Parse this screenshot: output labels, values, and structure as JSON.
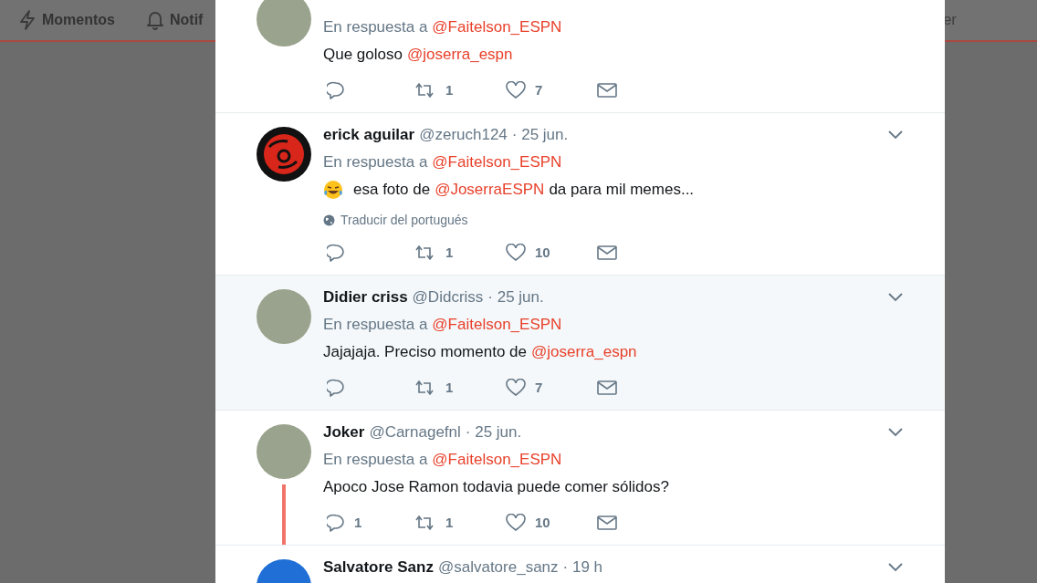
{
  "nav": {
    "items": [
      {
        "label": "Momentos"
      },
      {
        "label": "Notif"
      }
    ],
    "right_text": "er"
  },
  "tweets": [
    {
      "reply_prefix": "En respuesta a",
      "reply_to": "@Faitelson_ESPN",
      "text": [
        {
          "kind": "plain",
          "text": "Que goloso"
        },
        {
          "kind": "mention",
          "text": "@joserra_espn"
        }
      ],
      "retweets": "1",
      "likes": "7",
      "highlighted": false,
      "thread_continues": false
    },
    {
      "name": "erick aguilar",
      "handle": "@zeruch124",
      "time": "· 25 jun.",
      "reply_prefix": "En respuesta a",
      "reply_to": "@Faitelson_ESPN",
      "text": [
        {
          "kind": "emoji"
        },
        {
          "kind": "plain",
          "text": "esa foto de"
        },
        {
          "kind": "mention",
          "text": "@JoserraESPN"
        },
        {
          "kind": "plain",
          "text": "da para mil memes..."
        }
      ],
      "translate": "Traducir del portugués",
      "retweets": "1",
      "likes": "10",
      "highlighted": false,
      "thread_continues": false
    },
    {
      "name": "Didier criss",
      "handle": "@Didcriss",
      "time": "· 25 jun.",
      "reply_prefix": "En respuesta a",
      "reply_to": "@Faitelson_ESPN",
      "text": [
        {
          "kind": "plain",
          "text": "Jajajaja. Preciso momento de"
        },
        {
          "kind": "mention",
          "text": "@joserra_espn"
        }
      ],
      "retweets": "1",
      "likes": "7",
      "highlighted": true,
      "thread_continues": false
    },
    {
      "name": "Joker",
      "handle": "@Carnagefnl",
      "time": "· 25 jun.",
      "reply_prefix": "En respuesta a",
      "reply_to": "@Faitelson_ESPN",
      "text": [
        {
          "kind": "plain",
          "text": "Apoco Jose Ramon todavia puede comer sólidos?"
        }
      ],
      "replies": "1",
      "retweets": "1",
      "likes": "10",
      "highlighted": false,
      "thread_continues": true
    },
    {
      "name": "Salvatore Sanz",
      "handle": "@salvatore_sanz",
      "time": "· 19 h"
    }
  ]
}
